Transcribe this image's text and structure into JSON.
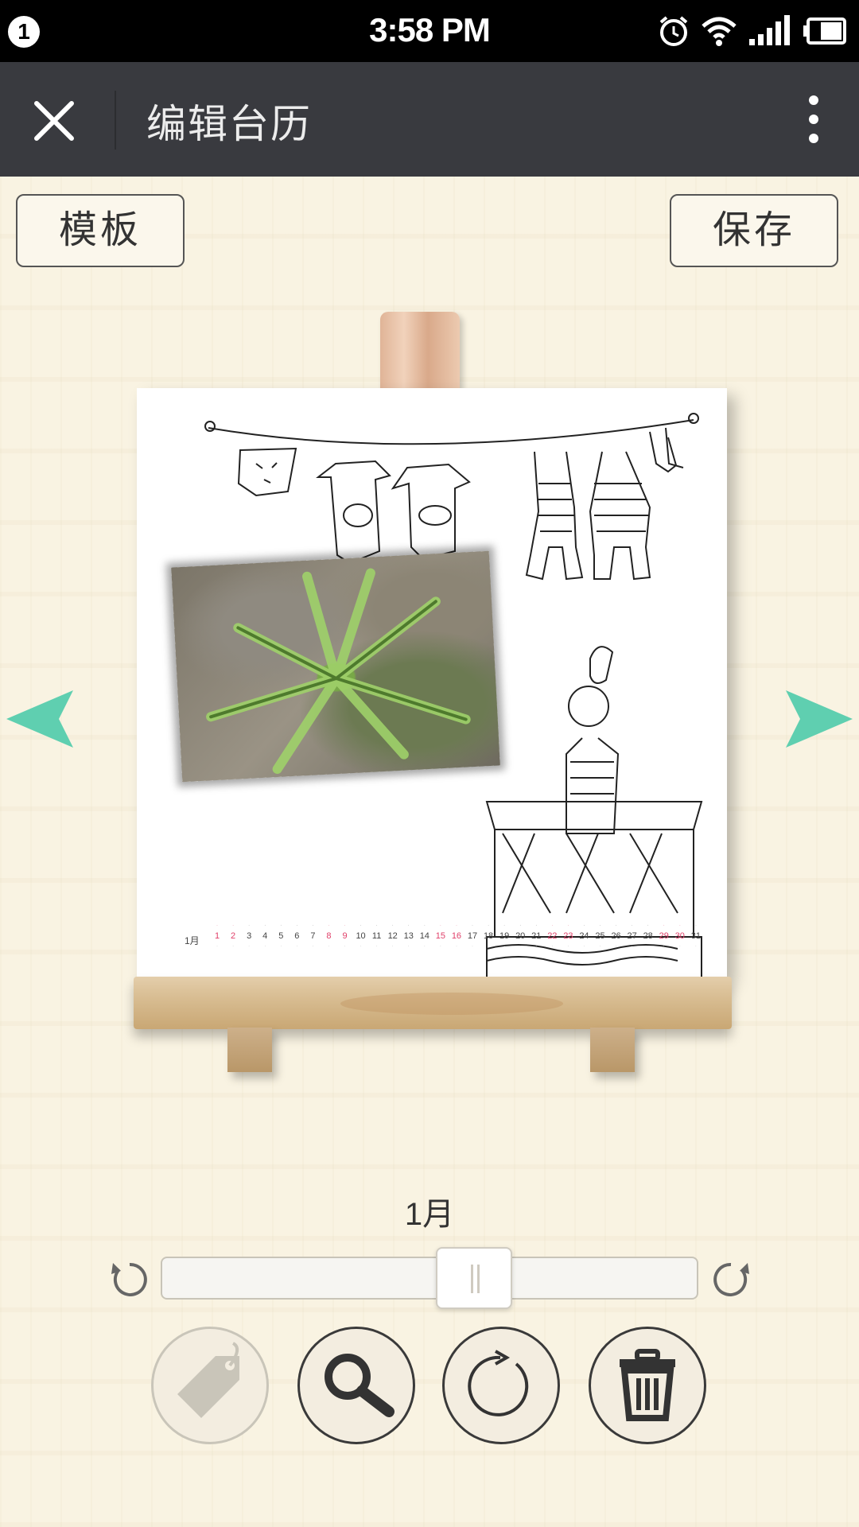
{
  "status_bar": {
    "notification_count": "1",
    "time": "3:58 PM",
    "icons": [
      "alarm-icon",
      "wifi-icon",
      "signal-icon",
      "battery-icon"
    ]
  },
  "title_bar": {
    "title": "编辑台历",
    "close_icon": "close-icon",
    "more_icon": "more-vertical-icon"
  },
  "toolbar": {
    "template_label": "模板",
    "save_label": "保存"
  },
  "calendar": {
    "month_mark": "1月",
    "days": [
      "1",
      "2",
      "3",
      "4",
      "5",
      "6",
      "7",
      "8",
      "9",
      "10",
      "11",
      "12",
      "13",
      "14",
      "15",
      "16",
      "17",
      "18",
      "19",
      "20",
      "21",
      "22",
      "23",
      "24",
      "25",
      "26",
      "27",
      "28",
      "29",
      "30",
      "31"
    ],
    "red_days": [
      1,
      2,
      8,
      9,
      15,
      16,
      22,
      23,
      29,
      30
    ]
  },
  "controls": {
    "month_label": "1月",
    "slider_position": 0.56,
    "rotate_left_icon": "rotate-ccw-icon",
    "rotate_right_icon": "rotate-cw-icon",
    "buttons": [
      {
        "icon": "tag-icon",
        "enabled": false
      },
      {
        "icon": "zoom-icon",
        "enabled": true
      },
      {
        "icon": "rotate-icon",
        "enabled": true
      },
      {
        "icon": "trash-icon",
        "enabled": true
      }
    ]
  },
  "colors": {
    "accent_arrow": "#5fcfb0",
    "title_bar_bg": "#393a3f",
    "background": "#f7f1df"
  }
}
